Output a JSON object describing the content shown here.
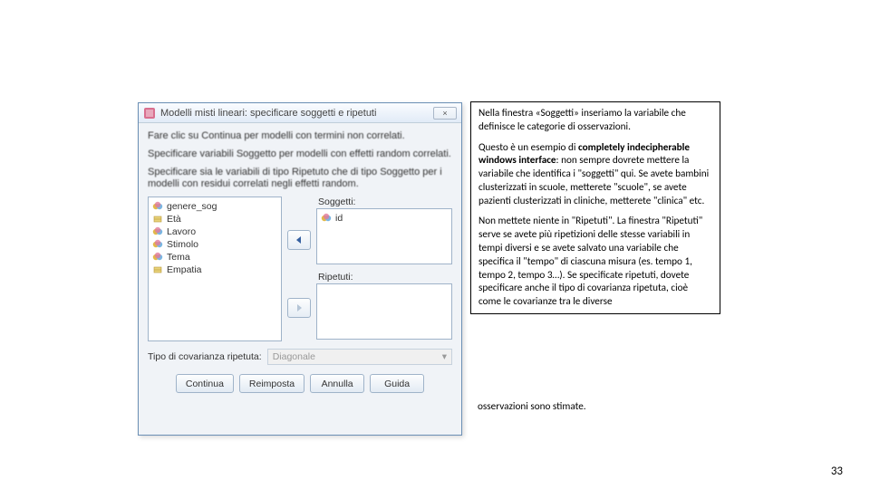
{
  "dialog": {
    "title": "Modelli misti lineari: specificare soggetti e ripetuti",
    "close": "×",
    "hint1": "Fare clic su Continua per modelli con termini non correlati.",
    "hint2": "Specificare variabili Soggetto per modelli con effetti random correlati.",
    "hint3": "Specificare sia le variabili di tipo Ripetuto che di tipo Soggetto per i modelli con residui correlati negli effetti random.",
    "soggetti_label": "Soggetti:",
    "ripetuti_label": "Ripetuti:",
    "vars": [
      "genere_sog",
      "Età",
      "Lavoro",
      "Stimolo",
      "Tema",
      "Empatia"
    ],
    "soggetti_items": [
      "id"
    ],
    "cov_label": "Tipo di covarianza ripetuta:",
    "cov_value": "Diagonale",
    "buttons": {
      "continua": "Continua",
      "reimposta": "Reimposta",
      "annulla": "Annulla",
      "guida": "Guida"
    }
  },
  "callout": {
    "p1": "Nella finestra «Soggetti» inseriamo la variabile che definisce le categorie di osservazioni.",
    "p2a": "Questo è un esempio di ",
    "p2b": "completely indecipherable windows interface",
    "p2c": ": non sempre dovrete mettere la variabile che identifica i \"soggetti\" qui. Se avete bambini clusterizzati in scuole, metterete \"scuole\", se avete pazienti clusterizzati in cliniche, metterete \"clinica\" etc.",
    "p3": "Non mettete niente in \"Ripetuti\". La finestra \"Ripetuti\" serve se avete più ripetizioni delle stesse variabili in tempi diversi e se avete salvato una variabile che specifica il \"tempo\" di ciascuna misura (es. tempo 1, tempo 2, tempo 3…). Se specificate ripetuti, dovete specificare anche il tipo di covarianza ripetuta, cioè come le covarianze tra le diverse",
    "overflow": "osservazioni sono stimate."
  },
  "page_number": "33"
}
